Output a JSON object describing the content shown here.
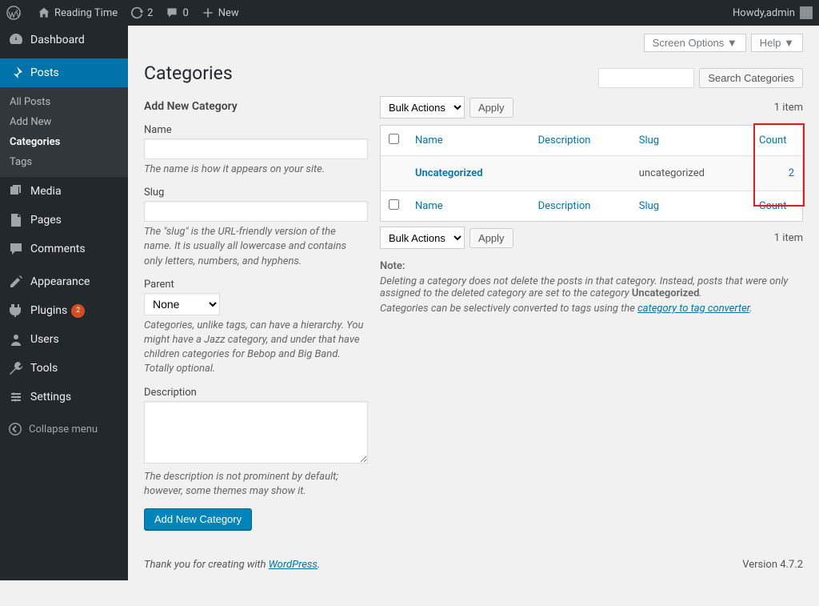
{
  "adminbar": {
    "site_name": "Reading Time",
    "refresh_count": "2",
    "comments_count": "0",
    "new_label": "New",
    "howdy_prefix": "Howdy, ",
    "user": "admin"
  },
  "sidebar": {
    "items": [
      {
        "label": "Dashboard"
      },
      {
        "label": "Posts"
      },
      {
        "label": "Media"
      },
      {
        "label": "Pages"
      },
      {
        "label": "Comments"
      },
      {
        "label": "Appearance"
      },
      {
        "label": "Plugins",
        "badge": "2"
      },
      {
        "label": "Users"
      },
      {
        "label": "Tools"
      },
      {
        "label": "Settings"
      }
    ],
    "collapse_label": "Collapse menu",
    "posts_submenu": [
      {
        "label": "All Posts"
      },
      {
        "label": "Add New"
      },
      {
        "label": "Categories"
      },
      {
        "label": "Tags"
      }
    ]
  },
  "page": {
    "title": "Categories",
    "screen_options": "Screen Options",
    "help": "Help",
    "search_btn": "Search Categories"
  },
  "form": {
    "heading": "Add New Category",
    "name_label": "Name",
    "name_desc": "The name is how it appears on your site.",
    "slug_label": "Slug",
    "slug_desc": "The \"slug\" is the URL-friendly version of the name. It is usually all lowercase and contains only letters, numbers, and hyphens.",
    "parent_label": "Parent",
    "parent_option": "None",
    "parent_desc": "Categories, unlike tags, can have a hierarchy. You might have a Jazz category, and under that have children categories for Bebop and Big Band. Totally optional.",
    "desc_label": "Description",
    "desc_desc": "The description is not prominent by default; however, some themes may show it.",
    "submit": "Add New Category"
  },
  "table": {
    "bulk_label": "Bulk Actions",
    "apply": "Apply",
    "item_count": "1 item",
    "cols": {
      "name": "Name",
      "description": "Description",
      "slug": "Slug",
      "count": "Count"
    },
    "rows": [
      {
        "name": "Uncategorized",
        "description": "",
        "slug": "uncategorized",
        "count": "2"
      }
    ]
  },
  "notes": {
    "heading": "Note:",
    "line1a": "Deleting a category does not delete the posts in that category. Instead, posts that were only assigned to the deleted category are set to the category ",
    "line1b": "Uncategorized",
    "line1c": ".",
    "line2a": "Categories can be selectively converted to tags using the ",
    "line2b": "category to tag converter",
    "line2c": "."
  },
  "footer": {
    "thanks_prefix": "Thank you for creating with ",
    "wp": "WordPress",
    "version": "Version 4.7.2"
  }
}
